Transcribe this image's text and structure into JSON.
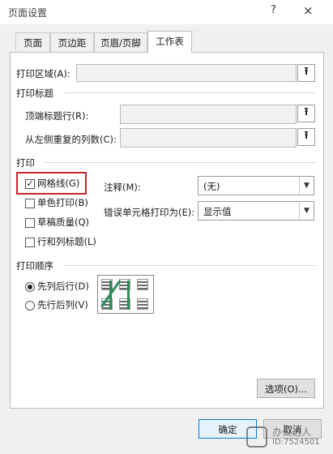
{
  "window": {
    "title": "页面设置",
    "help": "?",
    "close": "×"
  },
  "tabs": [
    {
      "label": "页面"
    },
    {
      "label": "页边距"
    },
    {
      "label": "页眉/页脚"
    },
    {
      "label": "工作表",
      "active": true
    }
  ],
  "print_area": {
    "label": "打印区域(A):",
    "value": ""
  },
  "print_titles": {
    "section": "打印标题",
    "rows_label": "顶端标题行(R):",
    "rows_value": "",
    "cols_label": "从左侧重复的列数(C):",
    "cols_value": ""
  },
  "print": {
    "section": "打印",
    "gridlines": {
      "label": "网格线(G)",
      "checked": true
    },
    "mono": {
      "label": "单色打印(B)",
      "checked": false
    },
    "draft": {
      "label": "草稿质量(Q)",
      "checked": false
    },
    "headings": {
      "label": "行和列标题(L)",
      "checked": false
    },
    "comments_label": "注释(M):",
    "comments_value": "(无)",
    "errors_label": "错误单元格打印为(E):",
    "errors_value": "显示值"
  },
  "page_order": {
    "section": "打印顺序",
    "down_then_over": {
      "label": "先列后行(D)",
      "selected": true
    },
    "over_then_down": {
      "label": "先行后列(V)",
      "selected": false
    }
  },
  "buttons": {
    "options": "选项(O)...",
    "ok": "确定",
    "cancel": "取消"
  },
  "watermark": {
    "line1": "办公达人",
    "line2": "ID:7524501"
  },
  "colors": {
    "highlight": "#c0272d",
    "preview_arrow": "#2e8b57",
    "ok_border": "#0078d7"
  }
}
